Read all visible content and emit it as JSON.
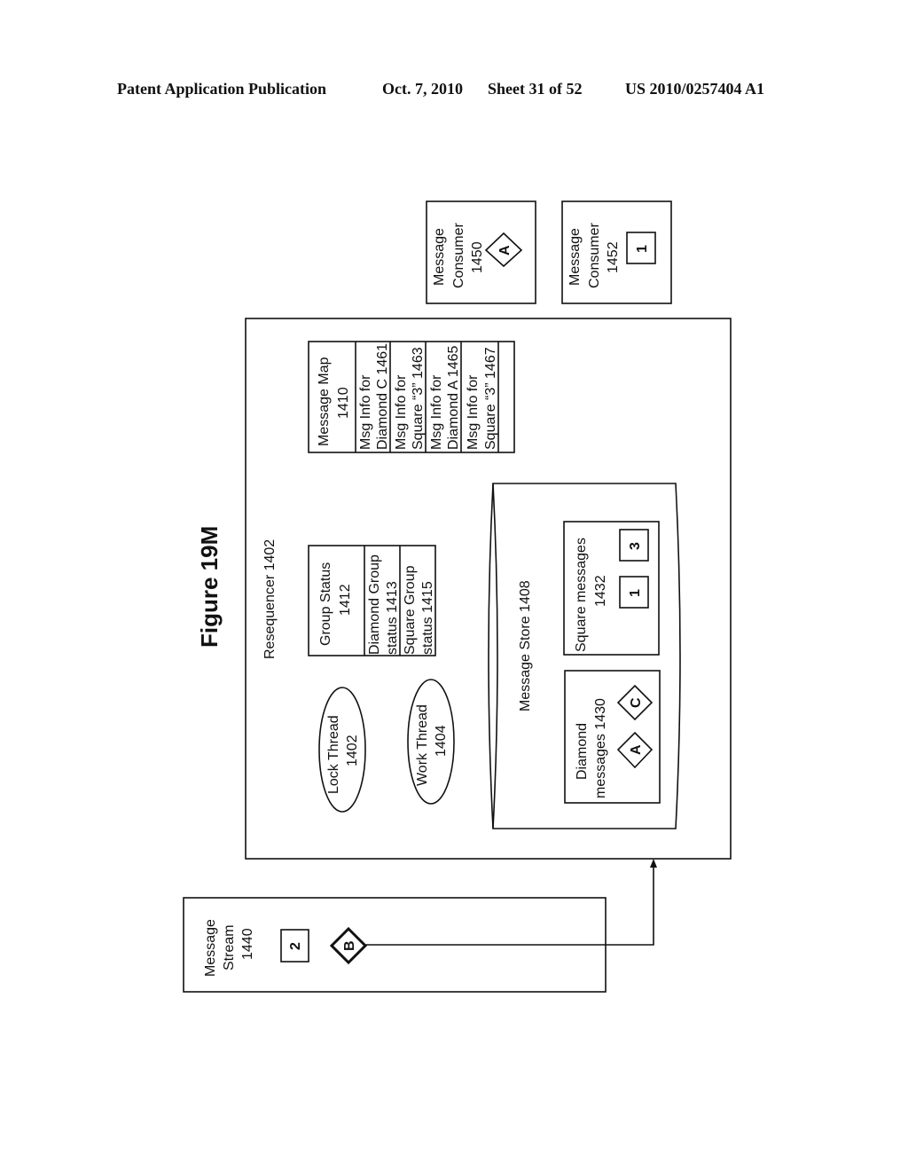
{
  "header": {
    "publication": "Patent Application Publication",
    "date": "Oct. 7, 2010",
    "sheet": "Sheet 31 of 52",
    "number": "US 2010/0257404 A1"
  },
  "figure": {
    "title": "Figure 19M",
    "resequencer": {
      "label": "Resequencer 1402",
      "lock_thread": [
        "Lock Thread",
        "1402"
      ],
      "work_thread": [
        "Work Thread",
        "1404"
      ],
      "group_status": {
        "title": [
          "Group Status",
          "1412"
        ],
        "rows": [
          [
            "Diamond  Group",
            "status 1413"
          ],
          [
            "Square  Group",
            "status 1415"
          ]
        ]
      },
      "message_map": {
        "title": [
          "Message Map",
          "1410"
        ],
        "rows": [
          [
            "Msg Info for",
            "Diamond C 1461"
          ],
          [
            "Msg Info for",
            "Square “3” 1463"
          ],
          [
            "Msg Info for",
            "Diamond A 1465"
          ],
          [
            "Msg Info for",
            "Square “3” 1467"
          ]
        ]
      },
      "message_store": {
        "label": "Message Store 1408",
        "diamond_messages": {
          "title": [
            "Diamond",
            "messages 1430"
          ],
          "items": [
            "A",
            "C"
          ]
        },
        "square_messages": {
          "title": [
            "Square messages",
            "1432"
          ],
          "items": [
            "1",
            "3"
          ]
        }
      }
    },
    "consumers": [
      {
        "title": [
          "Message",
          "Consumer",
          "1450"
        ],
        "item_type": "diamond",
        "item": "A"
      },
      {
        "title": [
          "Message",
          "Consumer",
          "1452"
        ],
        "item_type": "square",
        "item": "1"
      }
    ],
    "message_stream": {
      "title": [
        "Message",
        "Stream",
        "1440"
      ],
      "square_item": "2",
      "diamond_item": "B"
    }
  }
}
